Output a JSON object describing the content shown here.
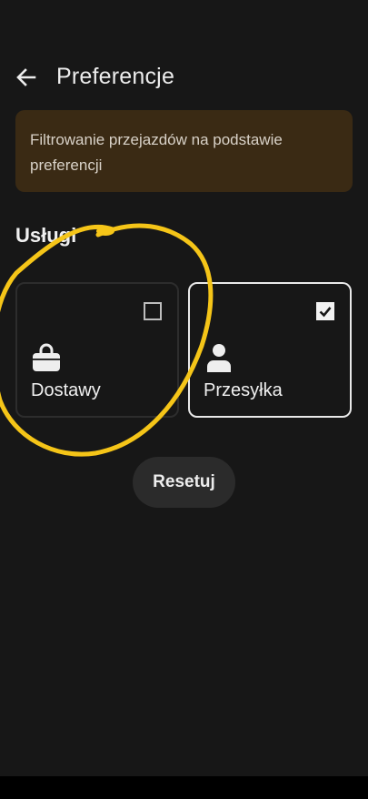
{
  "header": {
    "back_icon": "arrow-left-icon",
    "title": "Preferencje"
  },
  "banner": {
    "text": "Filtrowanie przejazdów na podstawie preferencji",
    "background_color": "#3a2a14"
  },
  "services": {
    "section_title": "Usługi",
    "items": [
      {
        "label": "Dostawy",
        "icon": "shopping-bag-icon",
        "checked": false
      },
      {
        "label": "Przesyłka",
        "icon": "person-icon",
        "checked": true
      }
    ]
  },
  "actions": {
    "reset_label": "Resetuj"
  },
  "annotation": {
    "type": "hand-drawn circle around Dostawy card",
    "color": "#f5c518"
  },
  "colors": {
    "background": "#171717",
    "selected_border": "#e9e9e9",
    "unselected_border": "#2d2d2d",
    "text": "#f0f0f0"
  }
}
